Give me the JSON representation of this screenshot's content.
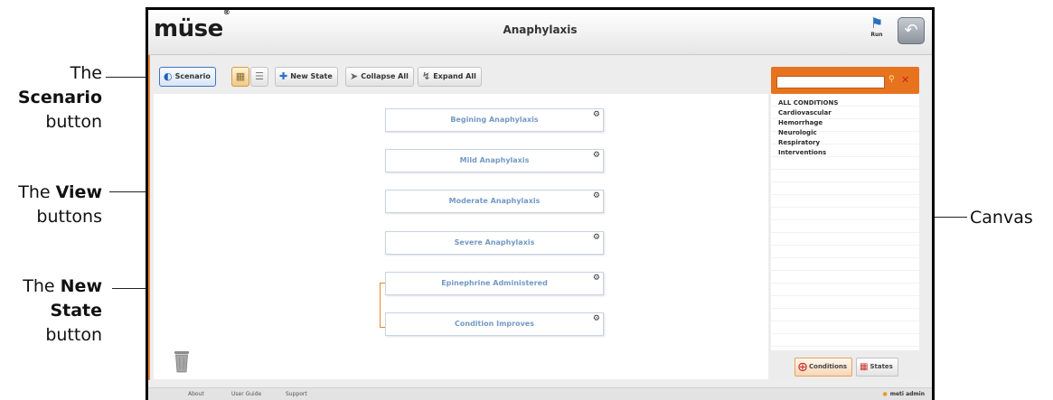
{
  "annotations": {
    "scenario": {
      "pre": "The",
      "bold": "Scenario",
      "post": "button"
    },
    "view": {
      "pre": "The",
      "bold": "View",
      "post": "buttons"
    },
    "new_state": {
      "pre": "The",
      "bold": "New",
      "bold2": "State",
      "post": "button"
    },
    "canvas": "Canvas"
  },
  "app": {
    "logo": "müse",
    "logo_mark": "®",
    "title": "Anaphylaxis",
    "run_label": "Run",
    "run_icon": "run-icon",
    "back_icon": "back-arrow-icon"
  },
  "toolbar": {
    "scenario_label": "Scenario",
    "new_state_label": "New State",
    "collapse_all_label": "Collapse All",
    "expand_all_label": "Expand All"
  },
  "canvas": {
    "states": [
      "Begining Anaphylaxis",
      "Mild Anaphylaxis",
      "Moderate Anaphylaxis",
      "Severe Anaphylaxis",
      "Epinephrine Administered",
      "Condition Improves"
    ],
    "transition_color": "#e0892f"
  },
  "side_panel": {
    "accent": "#e8731f",
    "conditions": [
      "ALL CONDITIONS",
      "Cardiovascular",
      "Hemorrhage",
      "Neurologic",
      "Respiratory",
      "Interventions"
    ],
    "tabs": {
      "conditions_label": "Conditions",
      "states_label": "States"
    }
  },
  "footer": {
    "links": [
      "About",
      "User Guide",
      "Support"
    ],
    "user": "meti admin"
  }
}
